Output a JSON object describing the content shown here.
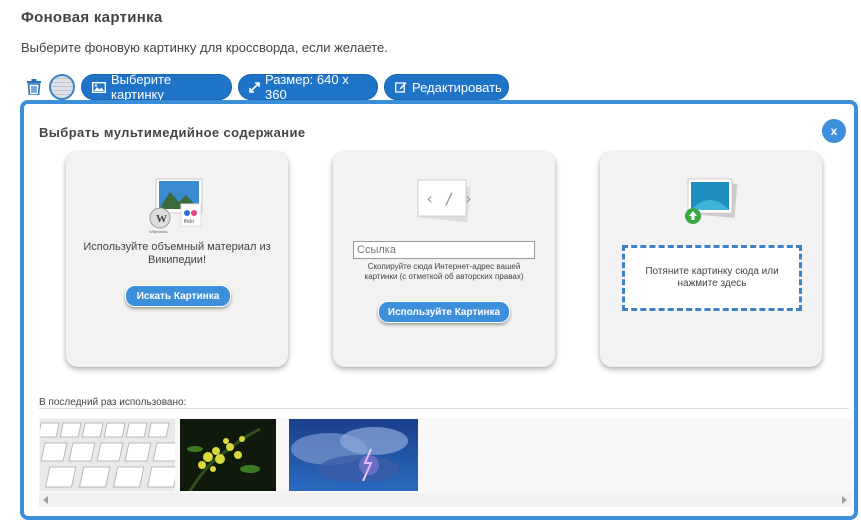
{
  "page": {
    "title": "Фоновая картинка",
    "subtitle": "Выберите фоновую картинку для кроссворда, если желаете."
  },
  "toolbar": {
    "choose_label": "Выберите картинку",
    "size_label": "Размер: 640 x 360",
    "edit_label": "Редактировать"
  },
  "dialog": {
    "title": "Выбрать мультимедийное содержание",
    "close_label": "x",
    "wikipedia": {
      "text_line1": "Используйте объемный материал из",
      "text_line2": "Википедии!",
      "button_label": "Искать Картинка",
      "logo_flickr": "flickr",
      "logo_wiki": "Wikimedia"
    },
    "url": {
      "placeholder": "Ссылка",
      "hint_line1": "Скопируйте сюда Интернет-адрес вашей",
      "hint_line2": "картинки (с отметкой об авторских правах)",
      "button_label": "Используйте Картинка",
      "code_glyph": "‹ / ›"
    },
    "upload": {
      "drop_text_line1": "Потяните картинку сюда или",
      "drop_text_line2": "нажмите здесь"
    },
    "recent": {
      "label": "В последний раз использовано:",
      "images": [
        "keyboard-photo",
        "yellow-flowers-photo",
        "storm-clouds-photo"
      ]
    }
  },
  "icons": {
    "trash": "trash-icon",
    "image": "image-icon",
    "resize": "resize-icon",
    "edit": "edit-icon",
    "close": "close-icon"
  },
  "colors": {
    "accent": "#1f74c8",
    "dialog_border": "#3b8fd8",
    "card_bg": "#f2f2f2"
  }
}
